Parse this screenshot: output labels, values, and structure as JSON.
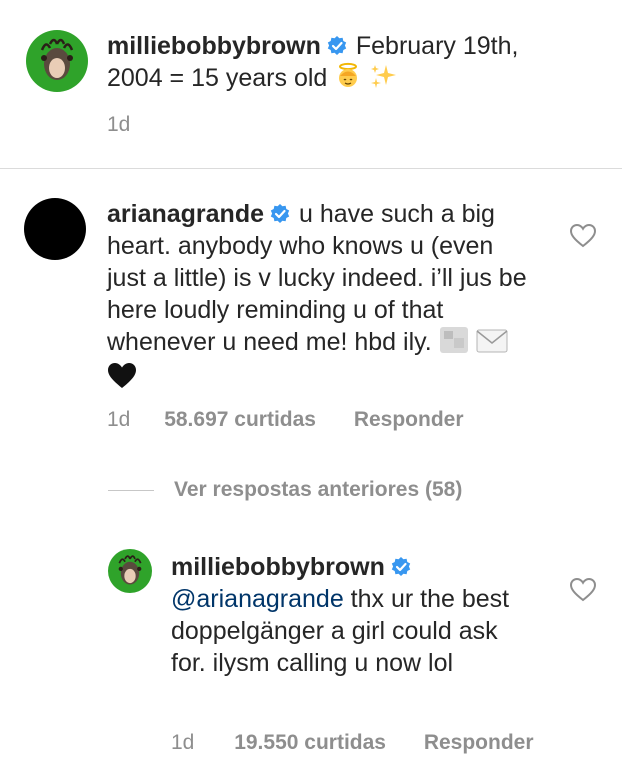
{
  "post": {
    "username": "milliebobbybrown",
    "caption": "February 19th, 2004 = 15 years old",
    "caption_emojis": [
      "angel-emoji",
      "sparkles-emoji"
    ],
    "time": "1d"
  },
  "comment": {
    "username": "arianagrande",
    "text": "u have such a big heart. anybody who knows u (even just a little) is v lucky indeed. i’ll jus be here loudly reminding u of that whenever u need me! hbd ily.",
    "trailing_emojis": [
      "blurred-image",
      "envelope-emoji",
      "black-heart-emoji"
    ],
    "time": "1d",
    "likes": "58.697 curtidas",
    "reply_label": "Responder"
  },
  "replies_toggle": {
    "label": "Ver respostas anteriores (58)"
  },
  "reply": {
    "username": "milliebobbybrown",
    "mention": "@arianagrande",
    "text": "thx ur the best doppelgänger a girl could ask for. ilysm calling u now lol",
    "time": "1d",
    "likes": "19.550 curtidas",
    "reply_label": "Responder"
  },
  "colors": {
    "verified": "#3897f0",
    "text": "#262626",
    "muted": "#8e8e8e",
    "mention": "#003569",
    "avatar_green": "#2fa32a"
  }
}
